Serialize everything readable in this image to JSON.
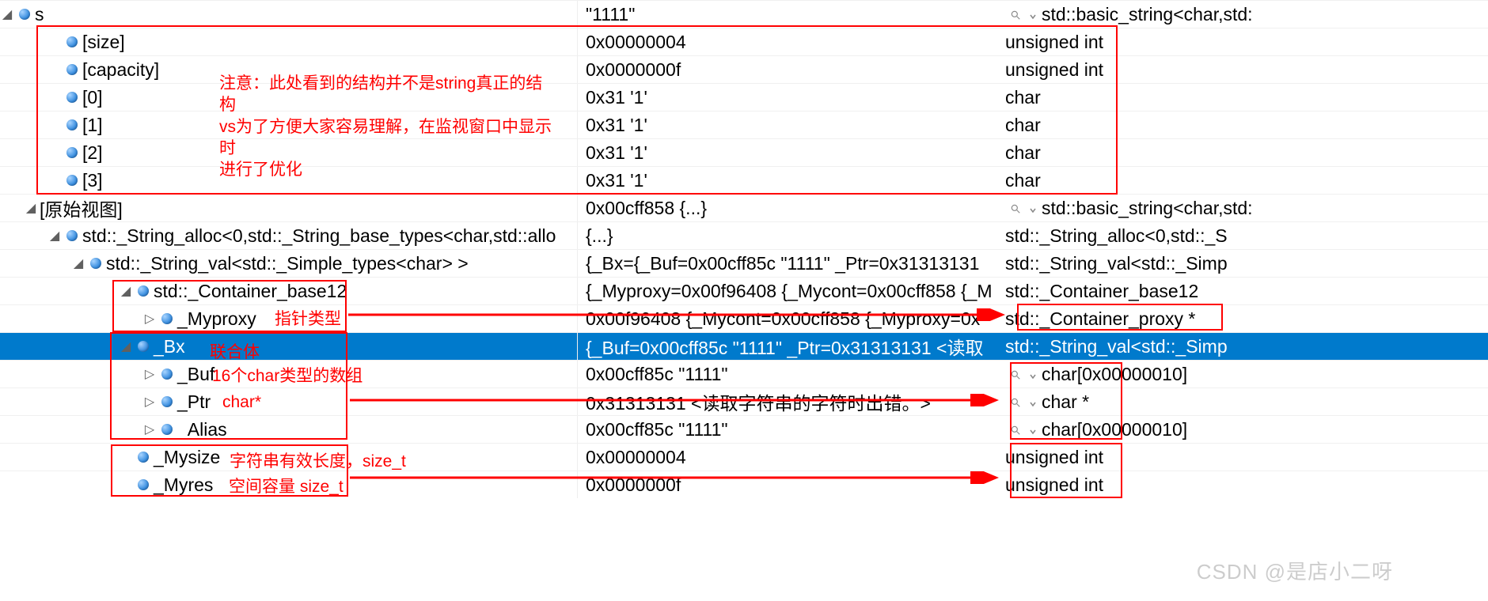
{
  "rows": [
    {
      "indent": 0,
      "expand": "open",
      "name": "s",
      "value": "\"1111\"",
      "type": "std::basic_string<char,std:",
      "mag": true,
      "selected": false,
      "magBeforeType": true
    },
    {
      "indent": 2,
      "expand": "none",
      "name": "[size]",
      "value": "0x00000004",
      "type": "unsigned int",
      "mag": false,
      "selected": false
    },
    {
      "indent": 2,
      "expand": "none",
      "name": "[capacity]",
      "value": "0x0000000f",
      "type": "unsigned int",
      "mag": false,
      "selected": false
    },
    {
      "indent": 2,
      "expand": "none",
      "name": "[0]",
      "value": "0x31 '1'",
      "type": "char",
      "mag": false,
      "selected": false
    },
    {
      "indent": 2,
      "expand": "none",
      "name": "[1]",
      "value": "0x31 '1'",
      "type": "char",
      "mag": false,
      "selected": false
    },
    {
      "indent": 2,
      "expand": "none",
      "name": "[2]",
      "value": "0x31 '1'",
      "type": "char",
      "mag": false,
      "selected": false
    },
    {
      "indent": 2,
      "expand": "none",
      "name": "[3]",
      "value": "0x31 '1'",
      "type": "char",
      "mag": false,
      "selected": false
    },
    {
      "indent": 1,
      "expand": "open",
      "name": "[原始视图]",
      "value": "0x00cff858 {...}",
      "type": "std::basic_string<char,std:",
      "mag": true,
      "selected": false,
      "magBeforeType": true,
      "noIco": true
    },
    {
      "indent": 2,
      "expand": "open",
      "name": "std::_String_alloc<0,std::_String_base_types<char,std::allo",
      "value": "{...}",
      "type": "std::_String_alloc<0,std::_S",
      "mag": false,
      "selected": false
    },
    {
      "indent": 3,
      "expand": "open",
      "name": "std::_String_val<std::_Simple_types<char> >",
      "value": "{_Bx={_Buf=0x00cff85c \"1111\" _Ptr=0x31313131",
      "type": "std::_String_val<std::_Simp",
      "mag": false,
      "selected": false
    },
    {
      "indent": 5,
      "expand": "open",
      "name": "std::_Container_base12",
      "value": "{_Myproxy=0x00f96408 {_Mycont=0x00cff858 {_M",
      "type": "std::_Container_base12",
      "mag": false,
      "selected": false
    },
    {
      "indent": 6,
      "expand": "closed",
      "name": "_Myproxy",
      "value": "0x00f96408 {_Mycont=0x00cff858 {_Myproxy=0x",
      "type": "std::_Container_proxy *",
      "mag": false,
      "selected": false
    },
    {
      "indent": 5,
      "expand": "open",
      "name": "_Bx",
      "value": "{_Buf=0x00cff85c \"1111\" _Ptr=0x31313131 <读取",
      "type": "std::_String_val<std::_Simp",
      "mag": false,
      "selected": true
    },
    {
      "indent": 6,
      "expand": "closed",
      "name": "_Buf",
      "value": "0x00cff85c \"1111\"",
      "type": "char[0x00000010]",
      "mag": true,
      "selected": false,
      "magBeforeType": true
    },
    {
      "indent": 6,
      "expand": "closed",
      "name": "_Ptr",
      "value": "0x31313131 <读取字符串的字符时出错。>",
      "type": "char *",
      "mag": true,
      "selected": false,
      "magBeforeType": true
    },
    {
      "indent": 6,
      "expand": "closed",
      "name": "_Alias",
      "value": "0x00cff85c \"1111\"",
      "type": "char[0x00000010]",
      "mag": true,
      "selected": false,
      "magBeforeType": true
    },
    {
      "indent": 5,
      "expand": "none",
      "name": "_Mysize",
      "value": "0x00000004",
      "type": "unsigned int",
      "mag": false,
      "selected": false
    },
    {
      "indent": 5,
      "expand": "none",
      "name": "_Myres",
      "value": "0x0000000f",
      "type": "unsigned int",
      "mag": false,
      "selected": false
    }
  ],
  "annotations": {
    "noteMain": "注意：此处看到的结构并不是string真正的结构\nvs为了方便大家容易理解，在监视窗口中显示时\n进行了优化",
    "labelPtrType": "指针类型",
    "labelUnion": "联合体",
    "labelBufArr": "16个char类型的数组",
    "labelCharPtr": "char*",
    "labelMysize": "字符串有效长度，size_t",
    "labelMyres": "空间容量  size_t",
    "watermark": "CSDN @是店小二呀"
  }
}
